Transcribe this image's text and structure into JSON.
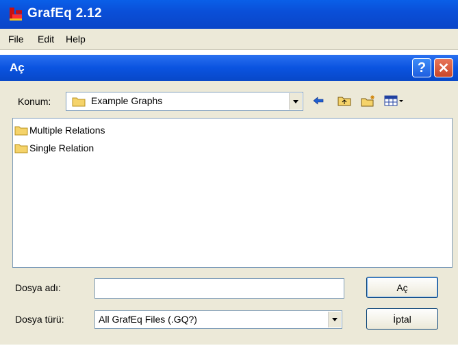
{
  "app": {
    "title": "GrafEq 2.12"
  },
  "menu": [
    "File",
    "Edit",
    "Help"
  ],
  "dialog": {
    "title": "Aç",
    "help_glyph": "?",
    "close_glyph": "✕",
    "location_label": "Konum:",
    "location_value": "Example Graphs",
    "items": [
      "Multiple Relations",
      "Single Relation"
    ],
    "filename_label": "Dosya adı:",
    "filename_value": "",
    "filetype_label": "Dosya türü:",
    "filetype_value": "All GrafEq Files (.GQ?)",
    "open_button": "Aç",
    "cancel_button": "İptal"
  },
  "colors": {
    "titlebar": "#0a4fd8",
    "dialog_bg": "#ece9d8",
    "folder": "#f5d36a"
  }
}
